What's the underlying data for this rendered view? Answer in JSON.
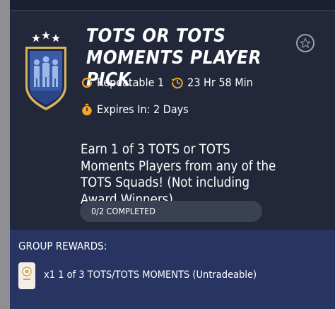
{
  "objective": {
    "title_line1": "TOTS OR TOTS",
    "title_line2": "MOMENTS PLAYER PICK",
    "repeatable": "Repeatable 1",
    "timer": "23 Hr 58 Min",
    "expires": "Expires In: 2 Days",
    "description": "Earn 1 of 3 TOTS or TOTS Moments Players from any of the TOTS Squads! (Not including Award Winners)",
    "progress_text": "0/2 COMPLETED",
    "progress_fraction": 0
  },
  "group_rewards": {
    "heading": "GROUP REWARDS:",
    "item": "x1 1 of 3 TOTS/TOTS MOMENTS (Untradeable)"
  },
  "icons": {
    "favorite": "star-icon",
    "repeatable": "refresh-icon",
    "timer": "clock-history-icon",
    "expires": "stopwatch-icon",
    "badge": "tots-shield-badge-icon",
    "reward": "player-pick-card-icon"
  },
  "colors": {
    "accent_orange": "#f5a623",
    "card_bg": "#22283a",
    "group_bg": "#283563",
    "badge_blue": "#3a5ca8",
    "badge_gold": "#d9b45a"
  }
}
